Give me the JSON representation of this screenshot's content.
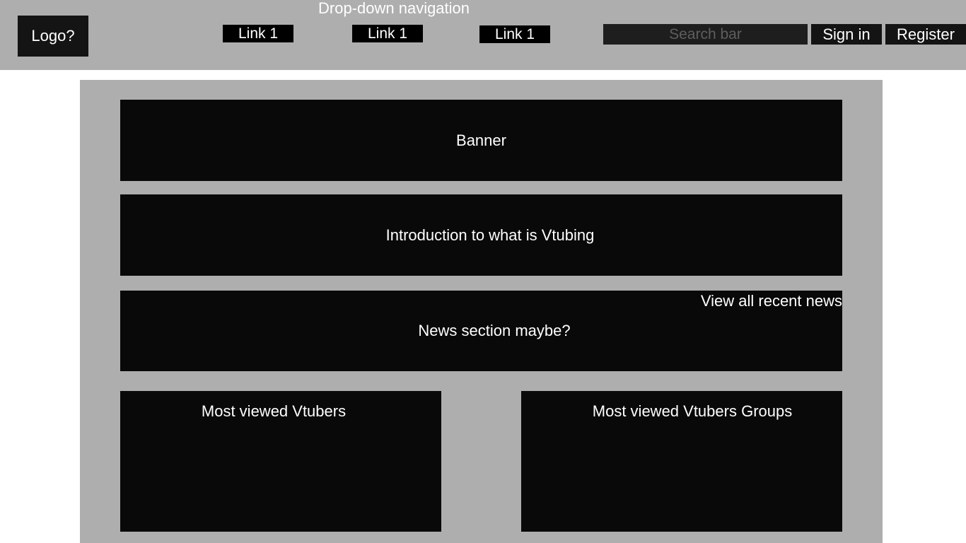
{
  "header": {
    "logo_label": "Logo?",
    "nav_caption": "Drop-down navigation",
    "nav_links": [
      "Link 1",
      "Link 1",
      "Link 1"
    ],
    "search_placeholder": "Search bar",
    "sign_in_label": "Sign in",
    "register_label": "Register"
  },
  "main": {
    "banner_label": "Banner",
    "intro_label": "Introduction to what is Vtubing",
    "news": {
      "title": "News section maybe?",
      "view_all_label": "View all recent news"
    },
    "panels": {
      "vtubers_title": "Most viewed Vtubers",
      "groups_title": "Most viewed Vtubers Groups"
    }
  },
  "colors": {
    "header_bg": "#aeaeae",
    "block_bg": "#090909",
    "text": "#ffffff"
  }
}
